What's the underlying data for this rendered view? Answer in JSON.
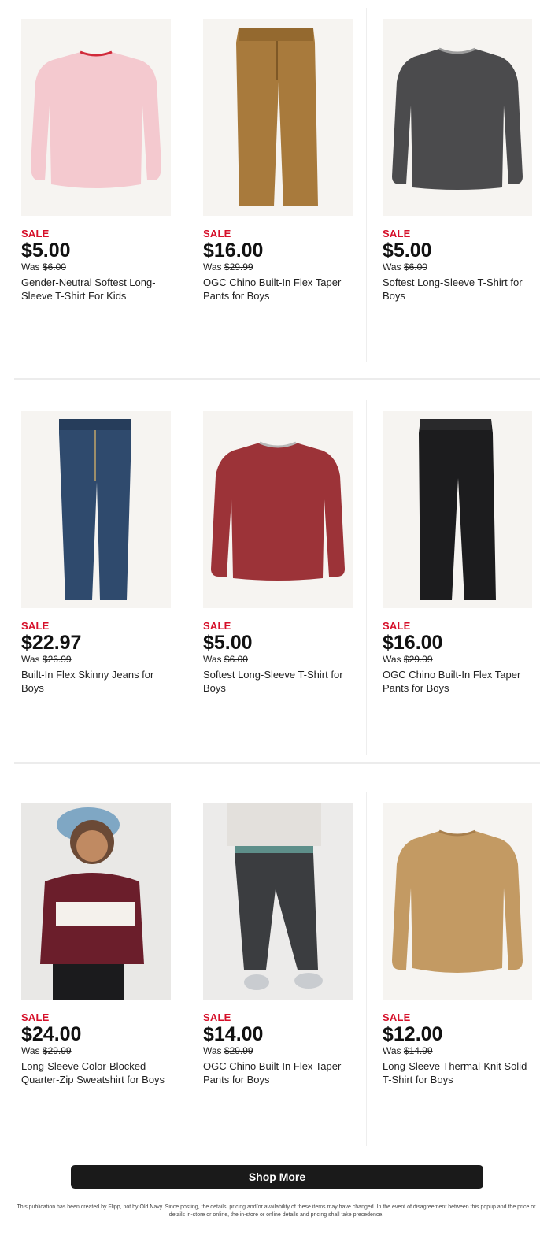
{
  "products": [
    {
      "sale": "SALE",
      "price": "$5.00",
      "was_prefix": "Was",
      "was_price": "$6.00",
      "name": "Gender-Neutral Softest Long-Sleeve T-Shirt For Kids",
      "image": "pink-long-sleeve-tshirt",
      "color": "#f4c9cf"
    },
    {
      "sale": "SALE",
      "price": "$16.00",
      "was_prefix": "Was",
      "was_price": "$29.99",
      "name": "OGC Chino Built-In Flex Taper Pants for Boys",
      "image": "tan-chino-pants",
      "color": "#a87a3c"
    },
    {
      "sale": "SALE",
      "price": "$5.00",
      "was_prefix": "Was",
      "was_price": "$6.00",
      "name": "Softest Long-Sleeve T-Shirt for Boys",
      "image": "charcoal-long-sleeve-tshirt",
      "color": "#4b4b4d"
    },
    {
      "sale": "SALE",
      "price": "$22.97",
      "was_prefix": "Was",
      "was_price": "$26.99",
      "name": "Built-In Flex Skinny Jeans for Boys",
      "image": "blue-skinny-jeans",
      "color": "#2f4a6d"
    },
    {
      "sale": "SALE",
      "price": "$5.00",
      "was_prefix": "Was",
      "was_price": "$6.00",
      "name": "Softest Long-Sleeve T-Shirt for Boys",
      "image": "red-long-sleeve-tshirt",
      "color": "#9c3338"
    },
    {
      "sale": "SALE",
      "price": "$16.00",
      "was_prefix": "Was",
      "was_price": "$29.99",
      "name": "OGC Chino Built-In Flex Taper Pants for Boys",
      "image": "black-chino-pants",
      "color": "#1c1c1e"
    },
    {
      "sale": "SALE",
      "price": "$24.00",
      "was_prefix": "Was",
      "was_price": "$29.99",
      "name": "Long-Sleeve Color-Blocked Quarter-Zip Sweatshirt for Boys",
      "image": "boy-burgundy-quarter-zip",
      "color": "#6b1e2b"
    },
    {
      "sale": "SALE",
      "price": "$14.00",
      "was_prefix": "Was",
      "was_price": "$29.99",
      "name": "OGC Chino Built-In Flex Taper Pants for Boys",
      "image": "boy-dark-chino-pants",
      "color": "#3b3d40"
    },
    {
      "sale": "SALE",
      "price": "$12.00",
      "was_prefix": "Was",
      "was_price": "$14.99",
      "name": "Long-Sleeve Thermal-Knit Solid T-Shirt for Boys",
      "image": "tan-thermal-tshirt",
      "color": "#c39a63"
    }
  ],
  "shop_more_label": "Shop More",
  "disclaimer": "This publication has been created by Flipp, not by Old Navy. Since posting, the details, pricing and/or availability of these items may have changed. In the event of disagreement between this popup and the price or details in-store or online, the in-store or online details and pricing shall take precedence.",
  "colors": {
    "sale_red": "#d6102a",
    "button_bg": "#1a1a1a",
    "image_bg": "#f6f4f1"
  }
}
